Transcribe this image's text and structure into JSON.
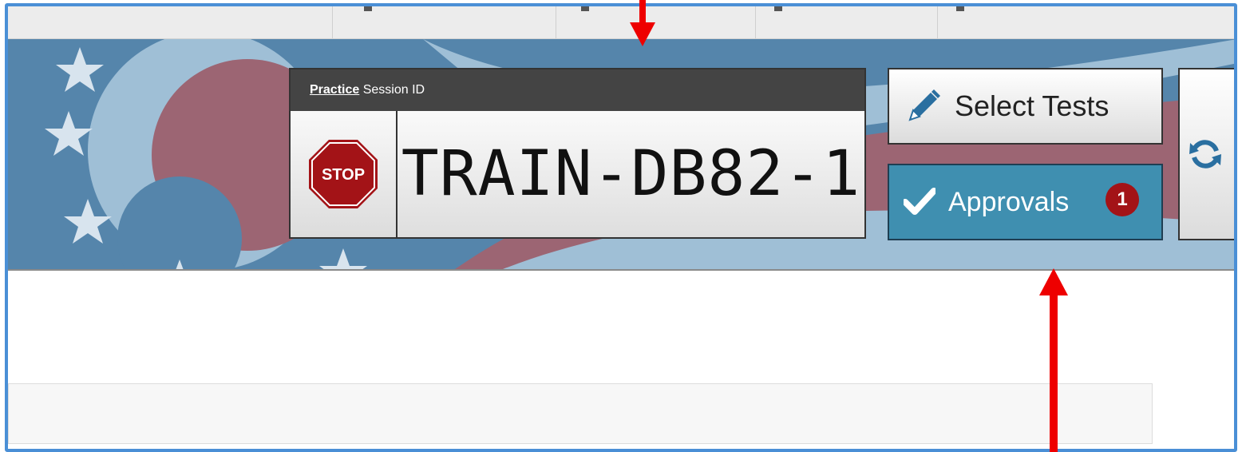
{
  "session": {
    "mode_label": "Practice",
    "id_label": "Session ID",
    "session_id": "TRAIN-DB82-1",
    "stop_text": "STOP"
  },
  "actions": {
    "select_tests_label": "Select Tests",
    "approvals_label": "Approvals",
    "approvals_count": "1"
  },
  "icons": {
    "stop": "stop-sign-icon",
    "select_tests": "pencil-icon",
    "approvals": "checkmark-icon",
    "refresh": "refresh-icon"
  },
  "colors": {
    "banner_blue": "#5585ab",
    "banner_red": "#9c6573",
    "session_header": "#444444",
    "approvals_button": "#3f8fb0",
    "badge_red": "#a31317",
    "annotation_arrow": "#ee0000",
    "frame_border": "#4a8fd6"
  }
}
